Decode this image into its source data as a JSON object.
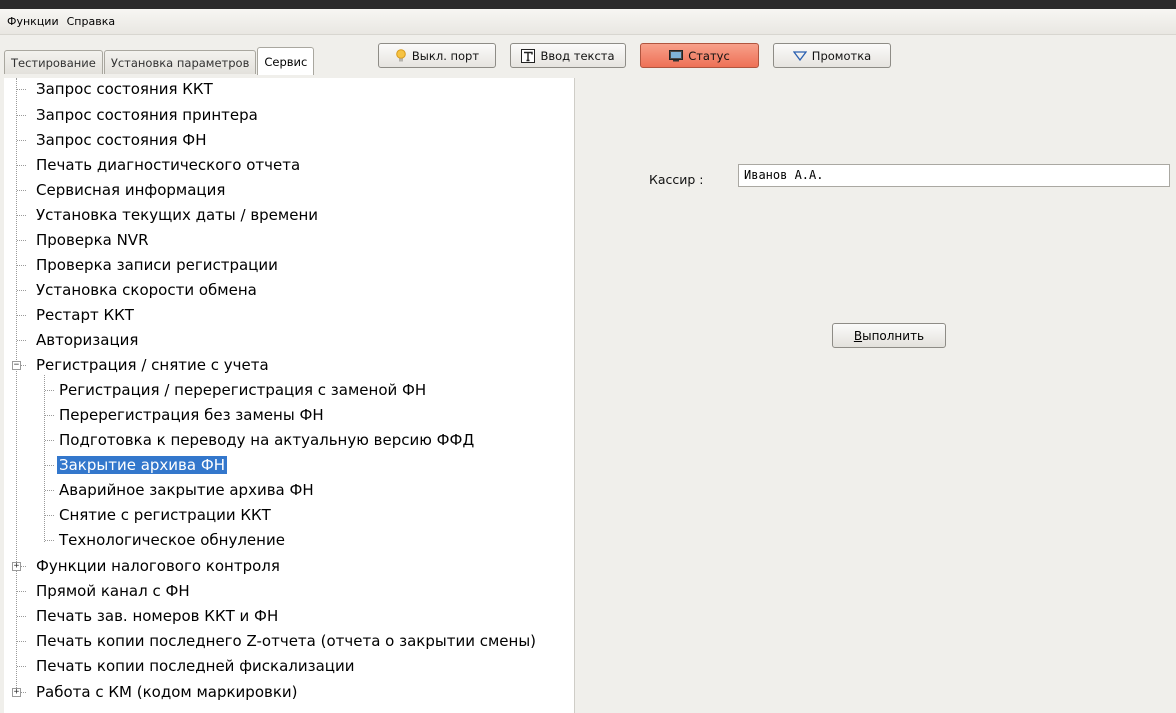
{
  "menu": [
    "Функции",
    "Справка"
  ],
  "tabs": [
    {
      "label": "Тестирование",
      "active": false
    },
    {
      "label": "Установка параметров",
      "active": false
    },
    {
      "label": "Сервис",
      "active": true
    }
  ],
  "toolbar": {
    "port_label": "Выкл. порт",
    "text_label": "Ввод текста",
    "status_label": "Статус",
    "feed_label": "Промотка"
  },
  "tree": {
    "items": [
      "Запрос состояния ККТ",
      "Запрос состояния принтера",
      "Запрос состояния ФН",
      "Печать диагностического отчета",
      "Сервисная информация",
      "Установка текущих даты / времени",
      "Проверка NVR",
      "Проверка записи регистрации",
      "Установка скорости обмена",
      "Рестарт ККТ",
      "Авторизация",
      "Регистрация / снятие с учета",
      "Регистрация / перерегистрация с заменой ФН",
      "Перерегистрация без замены ФН",
      "Подготовка к переводу на актуальную версию ФФД",
      "Закрытие архива ФН",
      "Аварийное закрытие архива ФН",
      "Снятие с регистрации ККТ",
      "Технологическое обнуление",
      "Функции налогового контроля",
      "Прямой канал с ФН",
      "Печать зав. номеров ККТ и ФН",
      "Печать копии последнего Z-отчета (отчета о закрытии смены)",
      "Печать копии последней фискализации",
      "Работа с КМ (кодом маркировки)"
    ],
    "selected": "Закрытие архива ФН"
  },
  "form": {
    "cashier_label": "Кассир :",
    "cashier_value": "Иванов А.А.",
    "run_label_u": "В",
    "run_label_rest": "ыполнить"
  }
}
